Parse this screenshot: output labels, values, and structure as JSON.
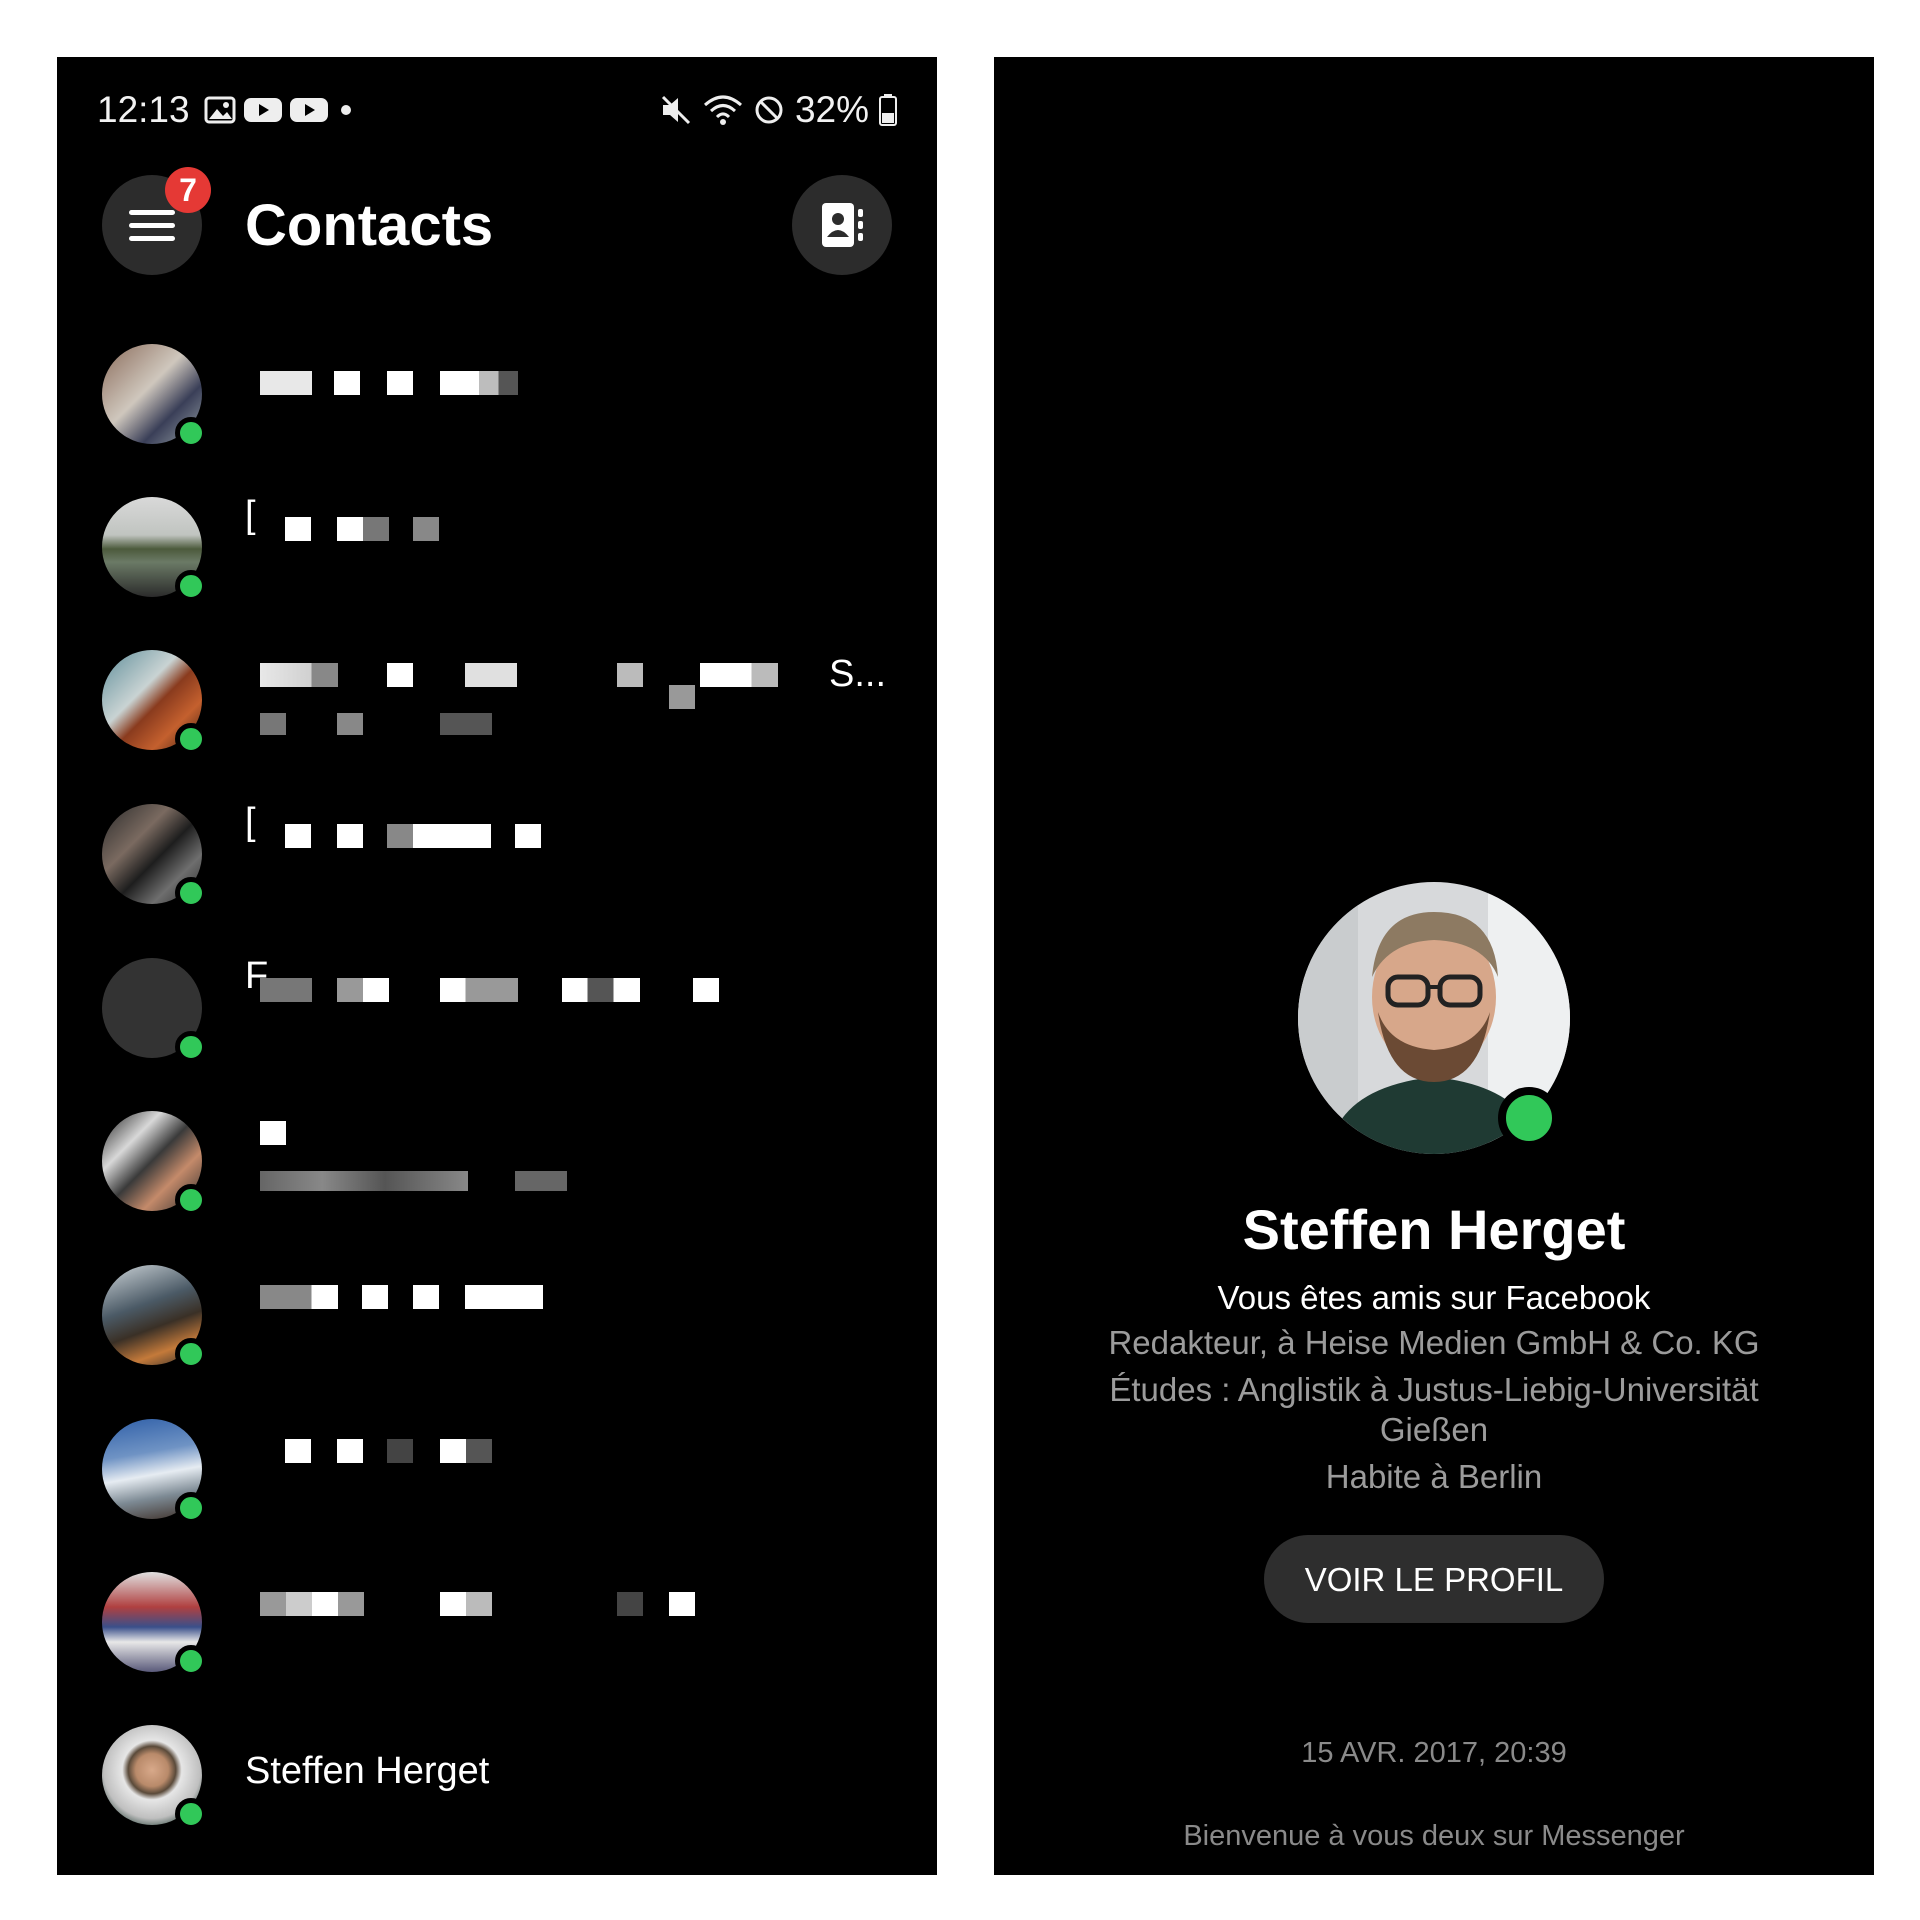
{
  "status_bar": {
    "time": "12:13",
    "battery": "32%"
  },
  "contacts_screen": {
    "title": "Contacts",
    "badge_count": "7",
    "list": [
      {
        "name": ""
      },
      {
        "name": "["
      },
      {
        "name": "S..."
      },
      {
        "name": "["
      },
      {
        "name": "F"
      },
      {
        "name": ""
      },
      {
        "name": ""
      },
      {
        "name": ""
      },
      {
        "name": ""
      },
      {
        "name": "Steffen Herget"
      }
    ]
  },
  "profile_screen": {
    "name": "Steffen Herget",
    "friends_text": "Vous êtes amis sur Facebook",
    "work": "Redakteur, à Heise Medien GmbH & Co. KG",
    "studies_line1": "Études : Anglistik à Justus-Liebig-Universität",
    "studies_line2": "Gießen",
    "lives": "Habite à Berlin",
    "view_profile_label": "VOIR LE PROFIL",
    "date": "15 AVR. 2017, 20:39",
    "welcome": "Bienvenue à vous deux sur Messenger"
  },
  "colors": {
    "online": "#31c859",
    "badge": "#e53935",
    "background": "#000000"
  }
}
